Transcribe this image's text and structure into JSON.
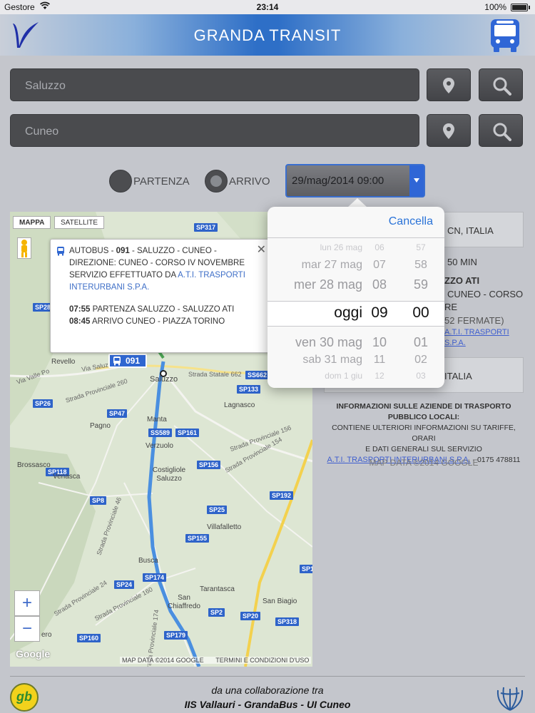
{
  "status": {
    "carrier": "Gestore",
    "time": "23:14",
    "battery": "100%"
  },
  "header": {
    "title": "GRANDA TRANSIT"
  },
  "search": {
    "from_value": "Saluzzo",
    "to_value": "Cuneo"
  },
  "options": {
    "departure_label": "PARTENZA",
    "arrival_label": "ARRIVO",
    "selected": "ARRIVO",
    "datetime": "29/mag/2014 09:00"
  },
  "map": {
    "type_map": "MAPPA",
    "type_satellite": "SATELLITE",
    "zoom_in": "+",
    "zoom_out": "−",
    "google": "Google",
    "footer_data": "MAP DATA ©2014 GOOGLE",
    "footer_terms": "TERMINI E CONDIZIONI D'USO",
    "bus_marker": "091",
    "places": [
      "Revello",
      "Saluzzo",
      "Lagnasco",
      "Pagno",
      "Manta",
      "Verzuolo",
      "Brossasco",
      "Venasca",
      "Costigliole Saluzzo",
      "Villafalletto",
      "Busca",
      "Tarantasca",
      "San Chiaffredo",
      "San Biagio",
      "ero"
    ],
    "roads": [
      "SP317",
      "SP28",
      "SP26",
      "SP47",
      "SP118",
      "SP8",
      "SP24",
      "SP160",
      "SS662",
      "SP133",
      "SP161",
      "SS589",
      "SP156",
      "SP25",
      "SP155",
      "SP192",
      "SP174",
      "SP20",
      "SP318",
      "SP179",
      "SP1",
      "SP2"
    ],
    "road_names": [
      "Via Saluzzo",
      "Via Valle Po",
      "Strada Provinciale 260",
      "Strada Statale 662",
      "Strada Provinciale 156",
      "Strada Provinciale 154",
      "Strada Provinciale 46",
      "Strada Provinciale 24",
      "Strada Provinciale 160",
      "Strada Provinciale 174"
    ]
  },
  "infowindow": {
    "type": "AUTOBUS - ",
    "line": "091",
    "route": " - SALUZZO - CUNEO - DIREZIONE: CUNEO - CORSO IV NOVEMBRE",
    "operator_prefix": "SERVIZIO EFFETTUATO DA ",
    "operator": "A.T.I. TRASPORTI INTERURBANI S.P.A.",
    "dep_time": "07:55",
    "dep_text": "PARTENZA SALUZZO - SALUZZO ATI",
    "arr_time": "08:45",
    "arr_text": "ARRIVO CUNEO - PIAZZA TORINO",
    "close": "✕"
  },
  "panel": {
    "origin": "CN, ITALIA",
    "duration": "50 MIN",
    "stop_title": "ZZO ATI",
    "stop_line1": "CUNEO - CORSO",
    "stop_line2": "RE",
    "stops_count": "52 FERMATE)",
    "operator_link1": "A.T.I. TRASPORTI",
    "operator_link2": "S.P.A.",
    "destination": "ITALIA",
    "info_head1": "INFORMAZIONI SULLE AZIENDE DI TRASPORTO",
    "info_head2": "PUBBLICO LOCALI:",
    "info_body1": "CONTIENE ULTERIORI INFORMAZIONI SU TARIFFE, ORARI",
    "info_body2": "E DATI GENERALI SUL SERVIZIO",
    "info_link": "A.T.I. TRASPORTI INTERURBANI S.P.A.",
    "info_phone": " - 0175 478811",
    "map_data": "MAP DATA ©2014 GOOGLE"
  },
  "picker": {
    "cancel": "Cancella",
    "rows": [
      {
        "day": "lun 26 mag",
        "hour": "06",
        "min": "57"
      },
      {
        "day": "mar 27 mag",
        "hour": "07",
        "min": "58"
      },
      {
        "day": "mer 28 mag",
        "hour": "08",
        "min": "59"
      },
      {
        "day": "oggi",
        "hour": "09",
        "min": "00"
      },
      {
        "day": "ven 30 mag",
        "hour": "10",
        "min": "01"
      },
      {
        "day": "sab 31 mag",
        "hour": "11",
        "min": "02"
      },
      {
        "day": "dom 1 giu",
        "hour": "12",
        "min": "03"
      }
    ]
  },
  "footer": {
    "line1": "da una collaborazione tra",
    "line2": "IIS Vallauri - GrandaBus - UI Cuneo",
    "gb_logo": "gb"
  },
  "colors": {
    "accent": "#2f66d6",
    "header_blue": "#2e6fc7",
    "route": "#4a8fe0",
    "link": "#3f5fcf"
  }
}
